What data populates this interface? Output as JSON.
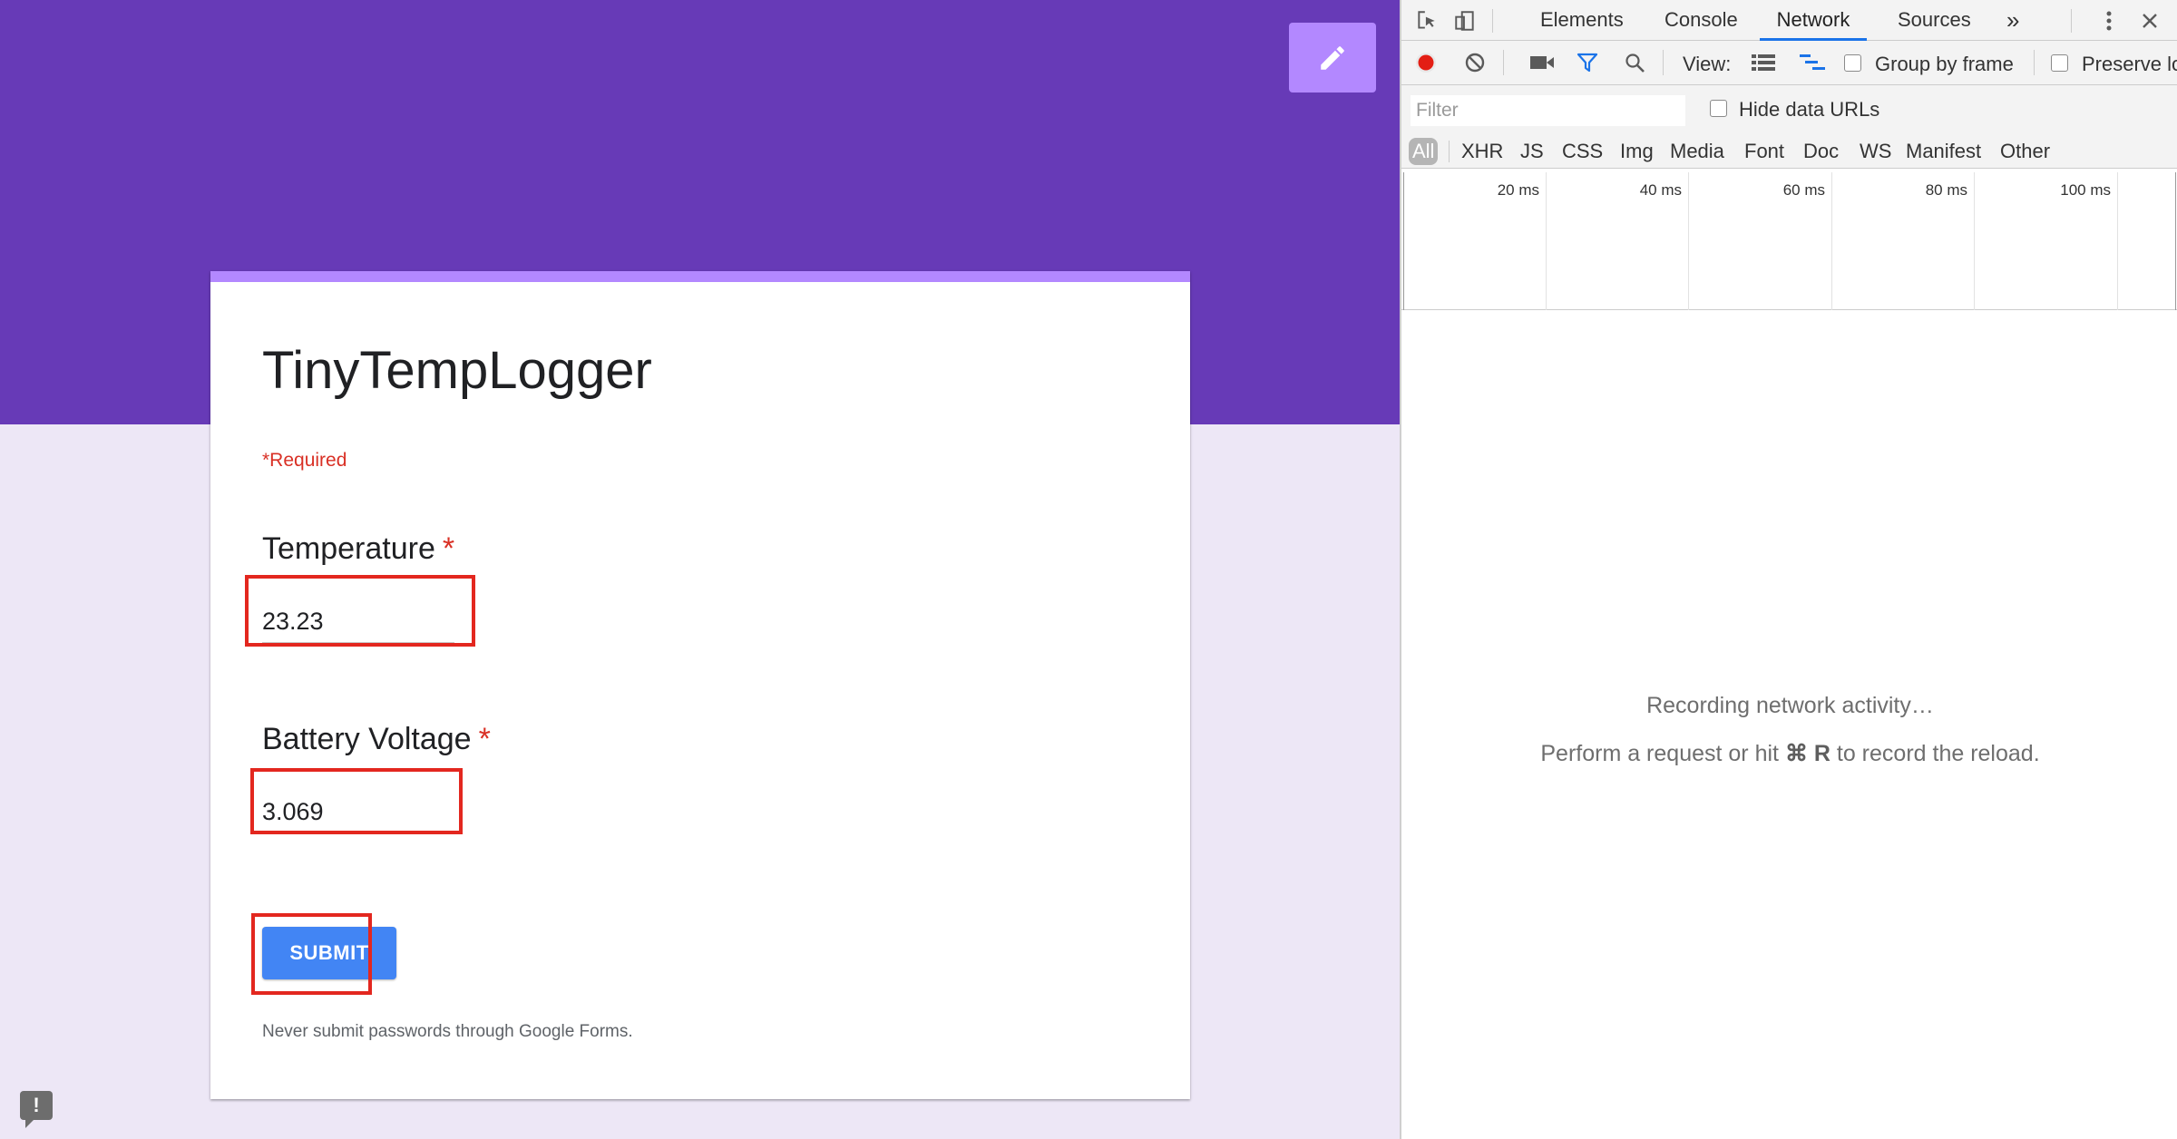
{
  "form": {
    "title": "TinyTempLogger",
    "required_note": "*Required",
    "questions": [
      {
        "label": "Temperature",
        "star": "*",
        "value": "23.23"
      },
      {
        "label": "Battery Voltage",
        "star": "*",
        "value": "3.069"
      }
    ],
    "submit_label": "SUBMIT",
    "disclaimer": "Never submit passwords through Google Forms.",
    "feedback_glyph": "!"
  },
  "colors": {
    "header": "#673ab7",
    "page_bg": "#ede7f6",
    "accent": "#b388ff",
    "submit": "#4285f4",
    "required": "#d93025",
    "highlight_box": "#e3271f",
    "devtools_active_tab": "#1a73e8"
  },
  "devtools": {
    "tabs": [
      {
        "label": "Elements"
      },
      {
        "label": "Console"
      },
      {
        "label": "Network",
        "active": true
      },
      {
        "label": "Sources"
      }
    ],
    "more_tabs": "»",
    "toolbar": {
      "view_label": "View:",
      "group_by_frame": "Group by frame",
      "preserve_log": "Preserve lo"
    },
    "filter": {
      "placeholder": "Filter",
      "hide_data_urls": "Hide data URLs",
      "types": [
        "All",
        "XHR",
        "JS",
        "CSS",
        "Img",
        "Media",
        "Font",
        "Doc",
        "WS",
        "Manifest",
        "Other"
      ]
    },
    "timeline_ticks": [
      "20 ms",
      "40 ms",
      "60 ms",
      "80 ms",
      "100 ms"
    ],
    "empty": {
      "line1": "Recording network activity…",
      "line2_before": "Perform a request or hit",
      "line2_keys": "⌘ R",
      "line2_after": "to record the reload."
    },
    "icons": [
      "inspect-element-icon",
      "device-toolbar-icon",
      "more-vert-icon",
      "close-icon",
      "record-icon",
      "clear-icon",
      "capture-screenshots-icon",
      "filter-icon",
      "search-icon",
      "large-rows-icon",
      "overview-icon"
    ]
  }
}
